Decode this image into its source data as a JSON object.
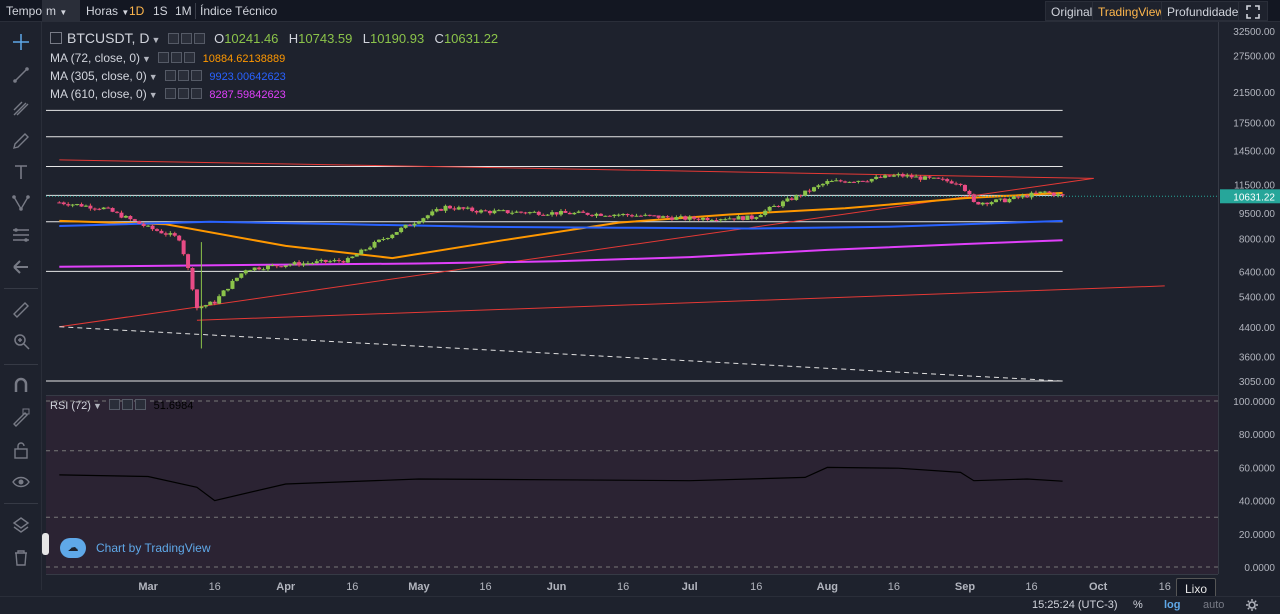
{
  "toolbar": {
    "tempo_label": "Tempo",
    "interval_select": "m",
    "hours_select": "Horas",
    "intervals": [
      "1D",
      "1S",
      "1M"
    ],
    "active_interval": "1D",
    "indicators_label": "Índice Técnico",
    "views": [
      "Original",
      "TradingView",
      "Profundidade"
    ],
    "active_view": "TradingView",
    "fullscreen_icon": "fullscreen-icon"
  },
  "left_tools": [
    "crosshair-icon",
    "trendline-icon",
    "pitchfork-icon",
    "brush-icon",
    "text-icon",
    "pattern-icon",
    "fib-icon",
    "back-arrow-icon",
    "ruler-icon",
    "zoom-icon",
    "magnet-icon",
    "lock-drawing-icon",
    "lock-icon",
    "eye-icon",
    "layers-icon",
    "trash-icon"
  ],
  "legend": {
    "symbol": "BTCUSDT, D",
    "open_label": "O",
    "open": "10241.46",
    "high_label": "H",
    "high": "10743.59",
    "low_label": "L",
    "low": "10190.93",
    "close_label": "C",
    "close": "10631.22",
    "ma": [
      {
        "label": "MA (72, close, 0)",
        "value": "10884.62138889",
        "color": "#ff9800"
      },
      {
        "label": "MA (305, close, 0)",
        "value": "9923.00642623",
        "color": "#2962ff"
      },
      {
        "label": "MA (610, close, 0)",
        "value": "8287.59842623",
        "color": "#e040fb"
      }
    ],
    "rsi_label": "RSI (72)",
    "rsi_value": "51.6984"
  },
  "watermark": "Chart by TradingView",
  "tooltip": "Lixo",
  "status": {
    "time": "15:25:24 (UTC-3)",
    "percent": "%",
    "log": "log",
    "auto": "auto",
    "settings_icon": "gear-icon"
  },
  "chart_data": [
    {
      "type": "candlestick",
      "title": "BTCUSDT, D",
      "scale": "log",
      "y_ticks": [
        "32500.00",
        "27500.00",
        "21500.00",
        "17500.00",
        "14500.00",
        "11500.00",
        "9500.00",
        "8000.00",
        "6400.00",
        "5400.00",
        "4400.00",
        "3600.00",
        "3050.00"
      ],
      "x_ticks": [
        "Mar",
        "16",
        "Apr",
        "16",
        "May",
        "16",
        "Jun",
        "16",
        "Jul",
        "16",
        "Aug",
        "16",
        "Sep",
        "16",
        "Oct",
        "16"
      ],
      "last_price": "10631.22",
      "series": [
        {
          "name": "BTCUSDT close",
          "color": "#26a69a",
          "x": [
            "2020-02-10",
            "2020-02-20",
            "2020-03-01",
            "2020-03-08",
            "2020-03-12",
            "2020-03-16",
            "2020-03-23",
            "2020-04-01",
            "2020-04-15",
            "2020-04-29",
            "2020-05-07",
            "2020-05-15",
            "2020-05-31",
            "2020-06-15",
            "2020-06-30",
            "2020-07-15",
            "2020-07-27",
            "2020-08-01",
            "2020-08-10",
            "2020-08-17",
            "2020-08-31",
            "2020-09-03",
            "2020-09-10",
            "2020-09-19",
            "2020-09-23"
          ],
          "y": [
            10200,
            9800,
            8600,
            8000,
            5000,
            5200,
            6500,
            6700,
            6900,
            8800,
            9900,
            9600,
            9500,
            9400,
            9150,
            9200,
            10900,
            11700,
            11900,
            12250,
            11650,
            10150,
            10350,
            10950,
            10631
          ]
        },
        {
          "name": "MA (72, close, 0)",
          "color": "#ff9800",
          "x": [
            "2020-02-10",
            "2020-03-05",
            "2020-04-01",
            "2020-04-25",
            "2020-05-20",
            "2020-06-15",
            "2020-07-10",
            "2020-08-05",
            "2020-09-01",
            "2020-09-23"
          ],
          "y": [
            9000,
            8800,
            7600,
            7000,
            7900,
            8900,
            9400,
            9800,
            10500,
            10880
          ]
        },
        {
          "name": "MA (305, close, 0)",
          "color": "#2962ff",
          "x": [
            "2020-02-10",
            "2020-03-15",
            "2020-04-15",
            "2020-05-15",
            "2020-06-15",
            "2020-07-15",
            "2020-08-15",
            "2020-09-23"
          ],
          "y": [
            8700,
            8950,
            8800,
            8650,
            8600,
            8550,
            8650,
            9000
          ]
        },
        {
          "name": "MA (610, close, 0)",
          "color": "#e040fb",
          "x": [
            "2020-02-10",
            "2020-04-01",
            "2020-05-01",
            "2020-06-01",
            "2020-07-01",
            "2020-08-01",
            "2020-09-01",
            "2020-09-23"
          ],
          "y": [
            6600,
            6700,
            6750,
            6850,
            7050,
            7400,
            7700,
            7900
          ]
        }
      ],
      "horizontal_levels": [
        19000,
        15900,
        13000,
        10700,
        8950,
        6400,
        3050
      ],
      "trend_lines": [
        {
          "color": "#e53935",
          "style": "solid",
          "from": {
            "x": "2020-02-10",
            "y": 13600
          },
          "to": {
            "x": "2020-09-30",
            "y": 12000
          }
        },
        {
          "color": "#e53935",
          "style": "solid",
          "from": {
            "x": "2020-02-10",
            "y": 4400
          },
          "to": {
            "x": "2020-09-30",
            "y": 12000
          }
        },
        {
          "color": "#e53935",
          "style": "solid",
          "from": {
            "x": "2020-03-12",
            "y": 4600
          },
          "to": {
            "x": "2020-10-16",
            "y": 5800
          }
        },
        {
          "color": "#e0e0e0",
          "style": "dashed",
          "from": {
            "x": "2020-02-10",
            "y": 4400
          },
          "to": {
            "x": "2020-09-23",
            "y": 3050
          }
        }
      ]
    },
    {
      "type": "line",
      "title": "RSI (72)",
      "ylim": [
        0,
        100
      ],
      "y_ticks": [
        "100.0000",
        "80.0000",
        "60.0000",
        "40.0000",
        "20.0000",
        "0.0000"
      ],
      "levels": [
        70,
        30
      ],
      "series": [
        {
          "name": "RSI (72)",
          "color": "#000000",
          "x": [
            "2020-02-10",
            "2020-03-01",
            "2020-03-12",
            "2020-03-16",
            "2020-04-01",
            "2020-05-01",
            "2020-06-01",
            "2020-07-01",
            "2020-07-27",
            "2020-08-01",
            "2020-08-17",
            "2020-08-31",
            "2020-09-03",
            "2020-09-15",
            "2020-09-23"
          ],
          "y": [
            55.5,
            54.5,
            48,
            40,
            50,
            53,
            52.5,
            52,
            54,
            60,
            59.5,
            57,
            52,
            53,
            51.7
          ]
        }
      ]
    }
  ]
}
